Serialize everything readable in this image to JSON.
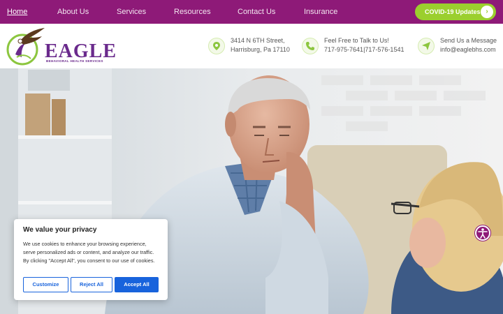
{
  "nav": {
    "items": [
      "Home",
      "About Us",
      "Services",
      "Resources",
      "Contact Us",
      "Insurance"
    ],
    "covid_button": "COVID-19 Updates"
  },
  "logo": {
    "word": "EAGLE",
    "subtitle": "BEHAVIORAL HEALTH SERVICES"
  },
  "contact": {
    "address_line1": "3414 N 6TH Street,",
    "address_line2": "Harrisburg, Pa 17110",
    "talk_label": "Feel Free to Talk to Us!",
    "phone1": "717-975-7641",
    "phone_separator": "|",
    "phone2": "717-576-1541",
    "message_label": "Send Us a Message",
    "email": "info@eaglebhs.com"
  },
  "cookie": {
    "title": "We value your privacy",
    "body": "We use cookies to enhance your browsing experience, serve personalized ads or content, and analyze our traffic. By clicking \"Accept All\", you consent to our use of cookies.",
    "customize": "Customize",
    "reject": "Reject All",
    "accept": "Accept All"
  },
  "colors": {
    "brand_purple": "#8e1a78",
    "brand_green": "#9bcf2e",
    "cookie_blue": "#1863dc"
  },
  "icons": {
    "address": "map-pin-icon",
    "phone": "phone-icon",
    "message": "paper-plane-icon",
    "covid_arrow": "chevron-right-icon",
    "accessibility": "accessibility-icon"
  }
}
